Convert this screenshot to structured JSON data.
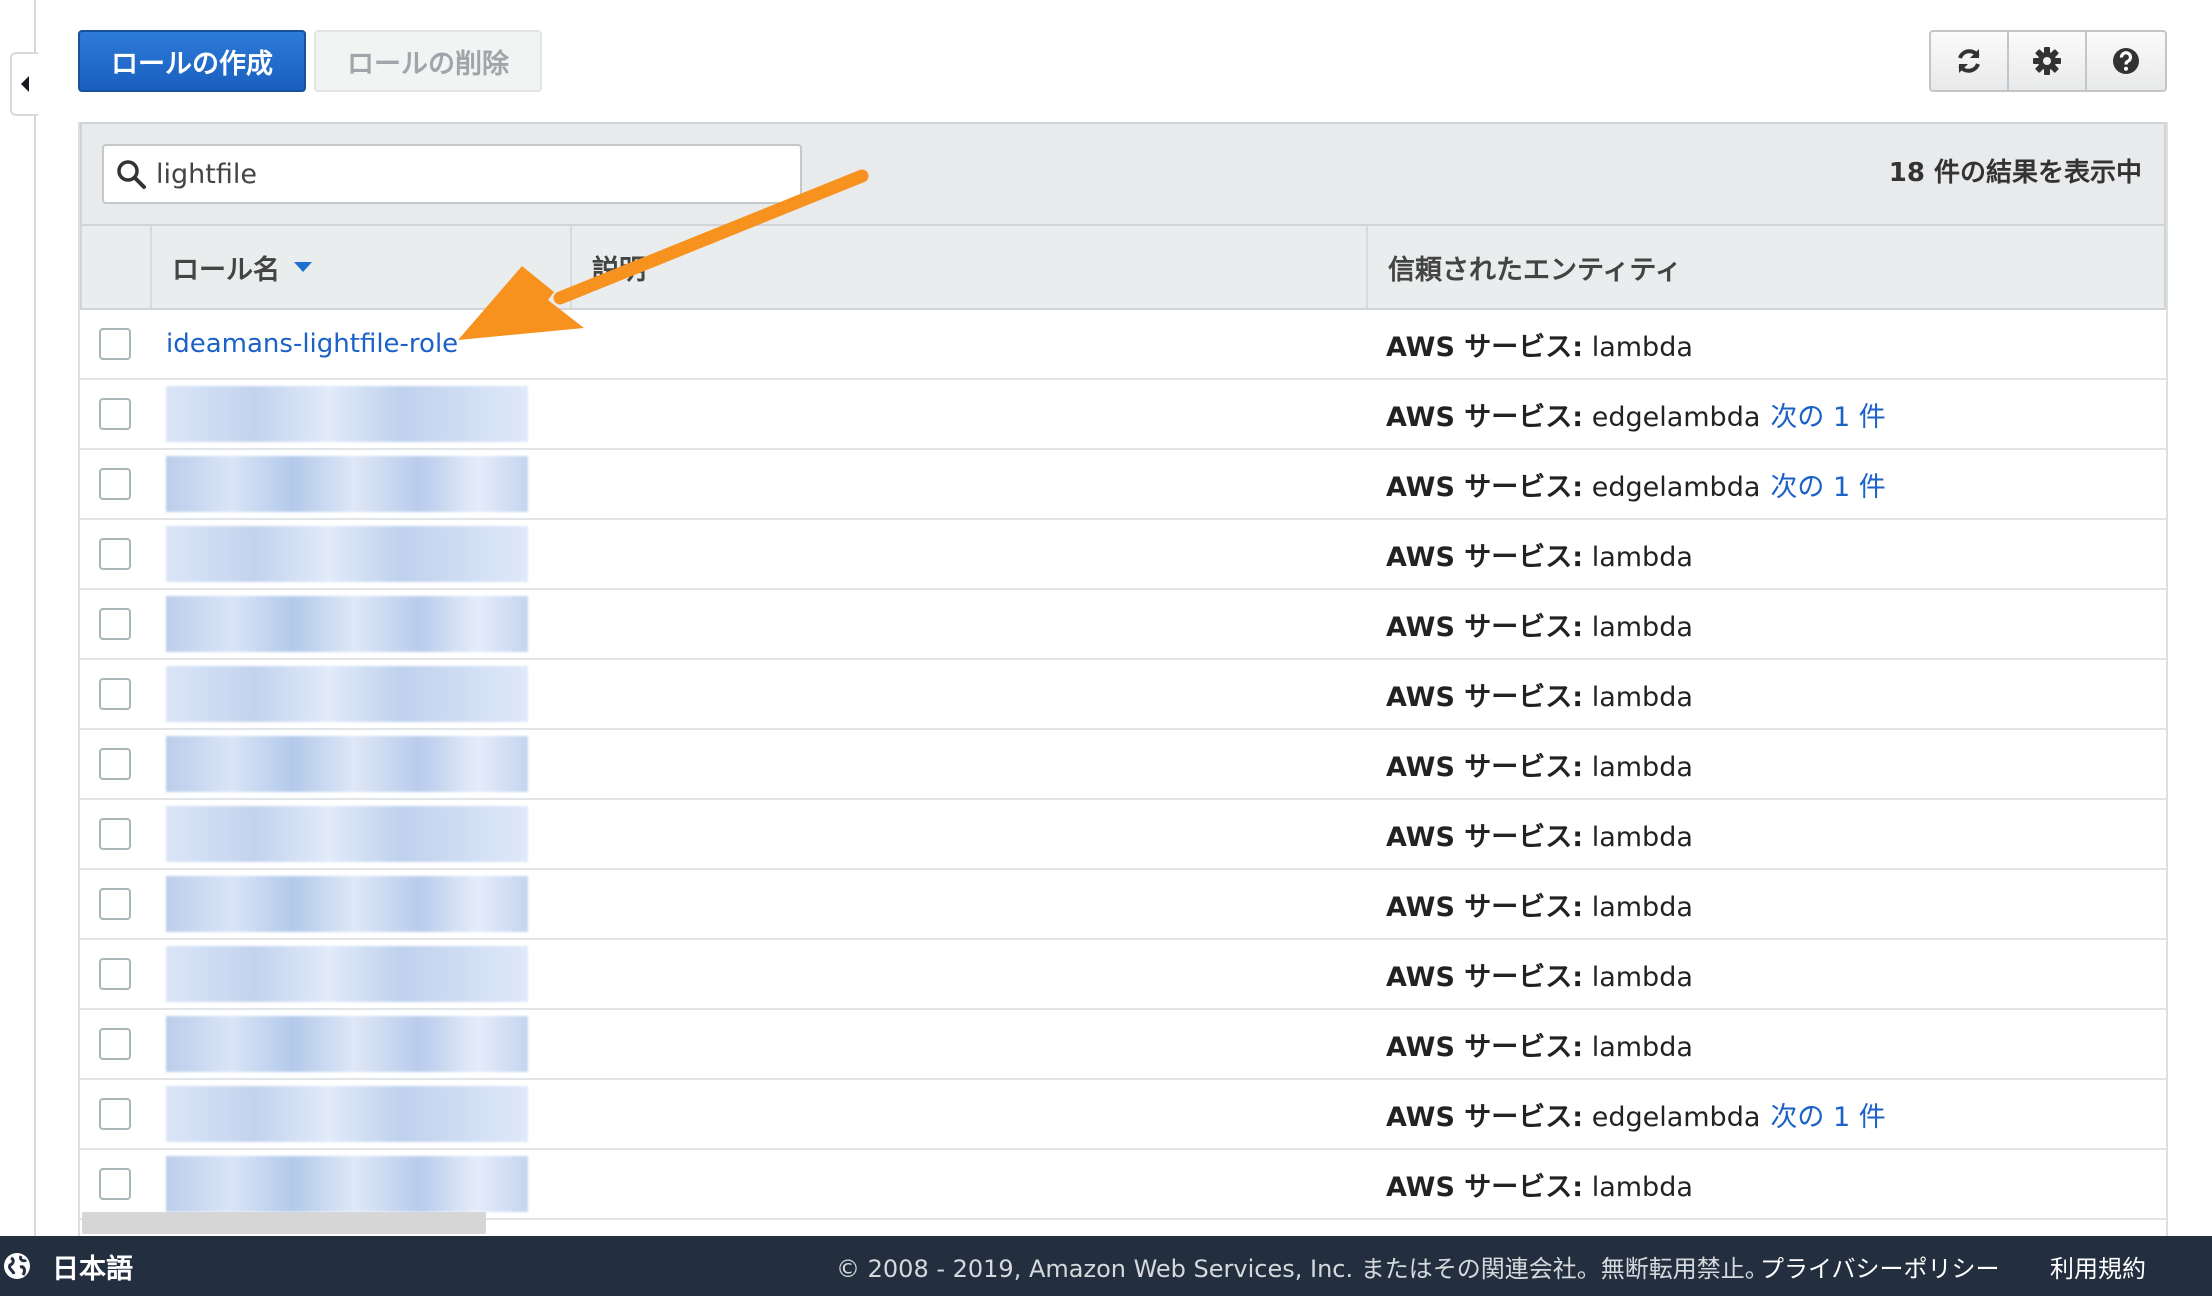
{
  "toolbar": {
    "create_role_label": "ロールの作成",
    "delete_role_label": "ロールの削除",
    "icons": [
      "refresh-icon",
      "gear-icon",
      "help-icon"
    ]
  },
  "filter": {
    "search_value": "lightfile",
    "result_count": "18 件の結果を表示中"
  },
  "table": {
    "columns": {
      "role_name": "ロール名",
      "description": "説明",
      "trusted_entity": "信頼されたエンティティ"
    },
    "rows": [
      {
        "role_name": "ideamans-lightfile-role",
        "entity_prefix": "AWS サービス:",
        "entity_value": "lambda",
        "more": ""
      },
      {
        "role_name": "",
        "entity_prefix": "AWS サービス:",
        "entity_value": "edgelambda",
        "more": "次の 1 件"
      },
      {
        "role_name": "",
        "entity_prefix": "AWS サービス:",
        "entity_value": "edgelambda",
        "more": "次の 1 件"
      },
      {
        "role_name": "",
        "entity_prefix": "AWS サービス:",
        "entity_value": "lambda",
        "more": ""
      },
      {
        "role_name": "",
        "entity_prefix": "AWS サービス:",
        "entity_value": "lambda",
        "more": ""
      },
      {
        "role_name": "",
        "entity_prefix": "AWS サービス:",
        "entity_value": "lambda",
        "more": ""
      },
      {
        "role_name": "",
        "entity_prefix": "AWS サービス:",
        "entity_value": "lambda",
        "more": ""
      },
      {
        "role_name": "",
        "entity_prefix": "AWS サービス:",
        "entity_value": "lambda",
        "more": ""
      },
      {
        "role_name": "",
        "entity_prefix": "AWS サービス:",
        "entity_value": "lambda",
        "more": ""
      },
      {
        "role_name": "",
        "entity_prefix": "AWS サービス:",
        "entity_value": "lambda",
        "more": ""
      },
      {
        "role_name": "",
        "entity_prefix": "AWS サービス:",
        "entity_value": "lambda",
        "more": ""
      },
      {
        "role_name": "",
        "entity_prefix": "AWS サービス:",
        "entity_value": "edgelambda",
        "more": "次の 1 件"
      },
      {
        "role_name": "",
        "entity_prefix": "AWS サービス:",
        "entity_value": "lambda",
        "more": ""
      }
    ]
  },
  "annotation": {
    "arrow_color": "#f7921e"
  },
  "footer": {
    "language": "日本語",
    "copyright": "© 2008 - 2019, Amazon Web Services, Inc. またはその関連会社。無断転用禁止。",
    "privacy_link": "プライバシーポリシー",
    "terms_link": "利用規約"
  },
  "colors": {
    "primary": "#1a5fbf",
    "link": "#1a62c8",
    "footer_bg": "#232f3e"
  }
}
